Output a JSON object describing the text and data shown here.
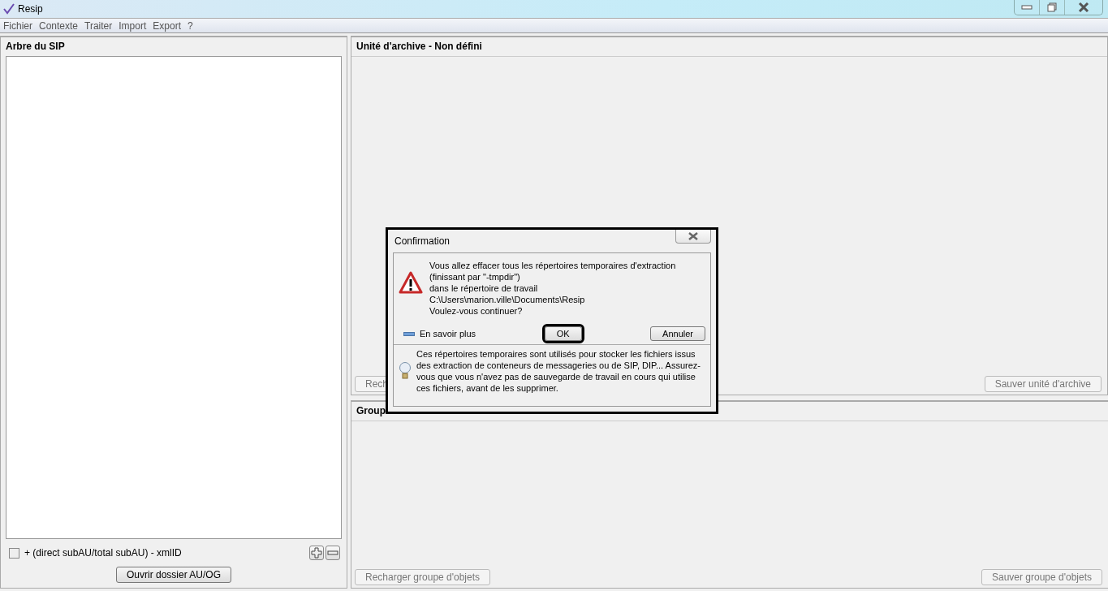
{
  "window": {
    "title": "Resip"
  },
  "menu": [
    "Fichier",
    "Contexte",
    "Traiter",
    "Import",
    "Export",
    "?"
  ],
  "tree_panel": {
    "title": "Arbre du SIP",
    "checkbox": {
      "label": "+ (direct subAU/total subAU) - xmlID",
      "checked": false
    },
    "open_button": "Ouvrir dossier AU/OG"
  },
  "archive_unit_panel": {
    "title": "Unité d'archive - Non défini",
    "buttons": [
      {
        "label": "Rech",
        "disabled": true
      },
      {
        "label": "Sauver unité d'archive",
        "disabled": true
      }
    ]
  },
  "object_group_panel": {
    "title": "Group",
    "buttons": [
      {
        "label": "Recharger groupe d'objets",
        "disabled": true
      },
      {
        "label": "Sauver groupe d'objets",
        "disabled": true
      }
    ]
  },
  "dialog": {
    "title": "Confirmation",
    "message_lines": [
      "Vous allez effacer tous les répertoires temporaires d'extraction",
      "(finissant par \"-tmpdir\")",
      "dans le répertoire de travail",
      "C:\\Users\\marion.ville\\Documents\\Resip",
      "Voulez-vous continuer?"
    ],
    "details_toggle": "En savoir plus",
    "buttons": [
      {
        "label": "OK",
        "selected": true
      },
      {
        "label": "Annuler",
        "selected": false
      }
    ],
    "details": "Ces répertoires temporaires sont utilisés pour stocker les fichiers issus des extraction de conteneurs de messageries ou de SIP, DIP... Assurez-vous que vous n'avez pas de sauvegarde de travail en cours qui utilise ces fichiers, avant de les supprimer."
  }
}
